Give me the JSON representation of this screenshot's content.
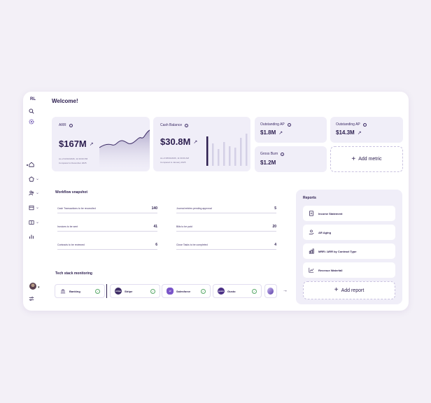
{
  "sidebar": {
    "initials": "RL",
    "items": [
      {
        "icon": "search-icon"
      },
      {
        "icon": "settings-icon"
      },
      {
        "icon": "home-icon"
      },
      {
        "icon": "pentagon-icon",
        "expandable": true
      },
      {
        "icon": "people-icon",
        "expandable": true
      },
      {
        "icon": "inbox-icon",
        "expandable": true
      },
      {
        "icon": "book-icon",
        "expandable": true
      },
      {
        "icon": "chart-icon"
      }
    ],
    "bottom": [
      {
        "icon": "avatar"
      },
      {
        "icon": "sliders-icon"
      }
    ]
  },
  "header": {
    "title": "Welcome!"
  },
  "metrics": {
    "arr": {
      "title": "ARR",
      "value": "$167M",
      "as_of": "As of 02/10/2026, 11:30:00 PM",
      "compared": "Compared to December 2025"
    },
    "cash": {
      "title": "Cash Balance",
      "value": "$30.8M",
      "as_of": "As of 08/01/2026, 11:30:00 AM",
      "compared": "Compared to January 2025"
    },
    "ap1": {
      "title": "Outstanding AP",
      "value": "$1.8M"
    },
    "ap2": {
      "title": "Outstanding AP",
      "value": "$14.3M"
    },
    "burn": {
      "title": "Gross Burn",
      "value": "$1.2M"
    },
    "add_metric": "Add metric"
  },
  "workflow": {
    "title": "Workflow snapshot",
    "left": [
      {
        "label": "Cash Transactions to be reconciled",
        "value": "140"
      },
      {
        "label": "Invoices to be sent",
        "value": "41"
      },
      {
        "label": "Contracts to be reviewed",
        "value": "6"
      }
    ],
    "right": [
      {
        "label": "Journal entries pending approval",
        "value": "5"
      },
      {
        "label": "Bills to be paid",
        "value": "20"
      },
      {
        "label": "Close Tasks to be completed",
        "value": "4"
      }
    ]
  },
  "reports": {
    "title": "Reports",
    "items": [
      {
        "label": "Income Statement",
        "icon": "document-icon"
      },
      {
        "label": "AR Aging",
        "icon": "hand-coin-icon"
      },
      {
        "label": "MRR / ARR by Contract Type",
        "icon": "bar-chart-icon"
      },
      {
        "label": "Revenue Waterfall",
        "icon": "line-chart-icon"
      }
    ],
    "add_report": "Add report"
  },
  "tech": {
    "title": "Tech stack monitoring",
    "items": [
      {
        "name": "Banking",
        "logo_text": "",
        "logo_color": "#6a5c88"
      },
      {
        "name": "Stripe",
        "logo_text": "stripe",
        "logo_color": "#3d2c66"
      },
      {
        "name": "Salesforce",
        "logo_text": "sf",
        "logo_color": "#7a55c9"
      },
      {
        "name": "Gusto",
        "logo_text": "gusto",
        "logo_color": "#4a2f85"
      }
    ]
  },
  "colors": {
    "accent": "#2b1d4e",
    "card_bg": "#f0eef8",
    "success": "#5aa96a"
  }
}
